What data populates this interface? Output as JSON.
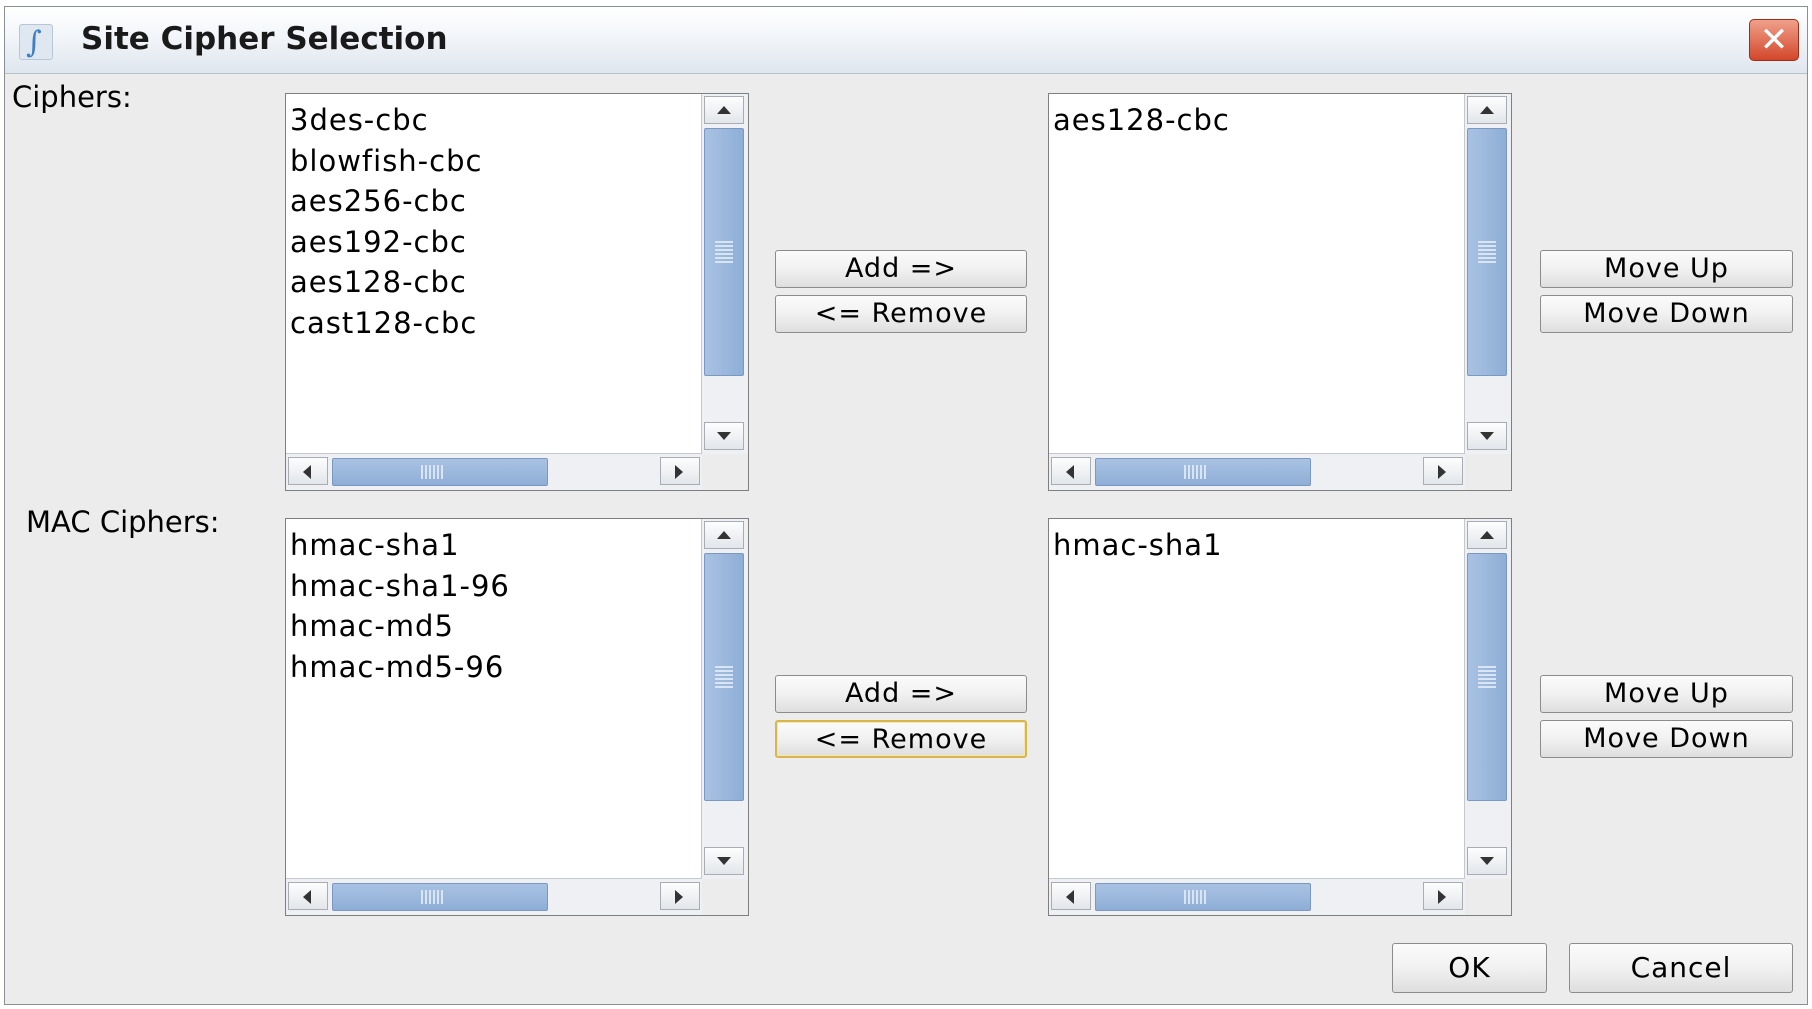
{
  "window": {
    "title": "Site Cipher Selection",
    "icon": "app-icon",
    "close_icon": "close-icon"
  },
  "ciphers": {
    "label": "Ciphers:",
    "available": [
      "3des-cbc",
      "blowfish-cbc",
      "aes256-cbc",
      "aes192-cbc",
      "aes128-cbc",
      "cast128-cbc"
    ],
    "selected": [
      "aes128-cbc"
    ],
    "add_label": "Add =>",
    "remove_label": "<= Remove",
    "move_up_label": "Move Up",
    "move_down_label": "Move Down"
  },
  "mac_ciphers": {
    "label": "MAC Ciphers:",
    "available": [
      "hmac-sha1",
      "hmac-sha1-96",
      "hmac-md5",
      "hmac-md5-96"
    ],
    "selected": [
      "hmac-sha1"
    ],
    "add_label": "Add =>",
    "remove_label": "<= Remove",
    "move_up_label": "Move Up",
    "move_down_label": "Move Down"
  },
  "footer": {
    "ok_label": "OK",
    "cancel_label": "Cancel"
  },
  "colors": {
    "scroll_thumb": "#9ab6dc",
    "close_button": "#d3472b",
    "focus_border": "#d9b64a"
  }
}
